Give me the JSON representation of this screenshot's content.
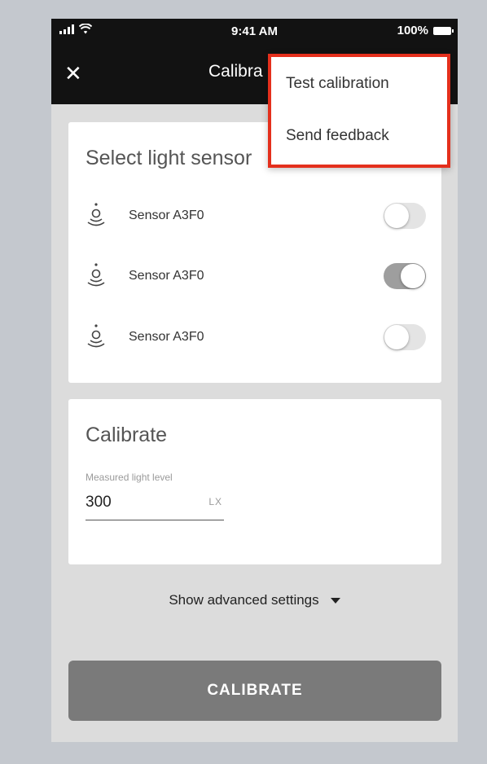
{
  "status_bar": {
    "time": "9:41 AM",
    "battery": "100%",
    "icons": [
      "signal-bars-icon",
      "wifi-icon",
      "battery-icon"
    ]
  },
  "app_bar": {
    "title": "Calibra",
    "close_icon": "close-icon"
  },
  "overflow_menu": {
    "items": [
      {
        "label": "Test calibration"
      },
      {
        "label": "Send feedback"
      }
    ],
    "highlight_color": "#e42f1c"
  },
  "sensor_card": {
    "title": "Select light sensor",
    "sensors": [
      {
        "label": "Sensor A3F0",
        "icon": "light-sensor-icon",
        "enabled": false
      },
      {
        "label": "Sensor A3F0",
        "icon": "light-sensor-icon",
        "enabled": true
      },
      {
        "label": "Sensor A3F0",
        "icon": "light-sensor-icon",
        "enabled": false
      }
    ]
  },
  "calibrate_card": {
    "title": "Calibrate",
    "field_label": "Measured light level",
    "field_value": "300",
    "field_unit": "LX"
  },
  "advanced": {
    "label": "Show advanced settings",
    "icon": "caret-down-icon"
  },
  "primary_button": {
    "label": "CALIBRATE",
    "color": "#7a7a7a"
  }
}
